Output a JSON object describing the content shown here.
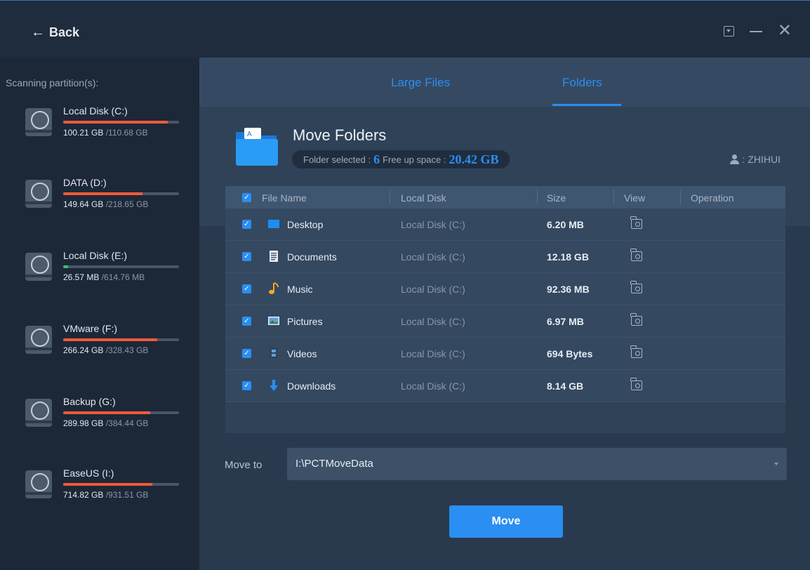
{
  "titlebar": {
    "back_label": "Back"
  },
  "sidebar": {
    "title": "Scanning partition(s):",
    "disks": [
      {
        "name": "Local Disk (C:)",
        "used": "100.21 GB",
        "total": "/110.68 GB",
        "fill_fraction": 0.905,
        "fill_color": "#ef5a39"
      },
      {
        "name": "DATA (D:)",
        "used": "149.64 GB",
        "total": "/218.65 GB",
        "fill_fraction": 0.684,
        "fill_color": "#ef5a39"
      },
      {
        "name": "Local Disk (E:)",
        "used": "26.57 MB",
        "total": "/614.76 MB",
        "fill_fraction": 0.043,
        "fill_color": "#35c46f"
      },
      {
        "name": "VMware (F:)",
        "used": "266.24 GB",
        "total": "/328.43 GB",
        "fill_fraction": 0.811,
        "fill_color": "#ef5a39"
      },
      {
        "name": "Backup (G:)",
        "used": "289.98 GB",
        "total": "/384.44 GB",
        "fill_fraction": 0.754,
        "fill_color": "#ef5a39"
      },
      {
        "name": "EaseUS (I:)",
        "used": "714.82 GB",
        "total": "/931.51 GB",
        "fill_fraction": 0.767,
        "fill_color": "#ef5a39"
      }
    ]
  },
  "tabs": {
    "large_files": "Large Files",
    "folders": "Folders",
    "active": "folders"
  },
  "header": {
    "title": "Move Folders",
    "folder_selected_label": "Folder selected :",
    "folder_selected_count": "6",
    "free_up_label": "Free up space :",
    "free_up_value": "20.42 GB",
    "user": ": ZHIHUI"
  },
  "table": {
    "columns": {
      "file_name": "File Name",
      "local_disk": "Local Disk",
      "size": "Size",
      "view": "View",
      "operation": "Operation"
    },
    "rows": [
      {
        "name": "Desktop",
        "disk": "Local Disk (C:)",
        "size": "6.20 MB",
        "icon": "desktop-icon"
      },
      {
        "name": "Documents",
        "disk": "Local Disk (C:)",
        "size": "12.18 GB",
        "icon": "document-icon"
      },
      {
        "name": "Music",
        "disk": "Local Disk (C:)",
        "size": "92.36 MB",
        "icon": "music-icon"
      },
      {
        "name": "Pictures",
        "disk": "Local Disk (C:)",
        "size": "6.97 MB",
        "icon": "picture-icon"
      },
      {
        "name": "Videos",
        "disk": "Local Disk (C:)",
        "size": "694 Bytes",
        "icon": "video-icon"
      },
      {
        "name": "Downloads",
        "disk": "Local Disk (C:)",
        "size": "8.14 GB",
        "icon": "download-icon"
      }
    ]
  },
  "move_to": {
    "label": "Move to",
    "value": "I:\\PCTMoveData"
  },
  "move_button": "Move",
  "colors": {
    "accent": "#2a8ef2",
    "disk_bar_high": "#ef5a39",
    "disk_bar_low": "#35c46f"
  }
}
